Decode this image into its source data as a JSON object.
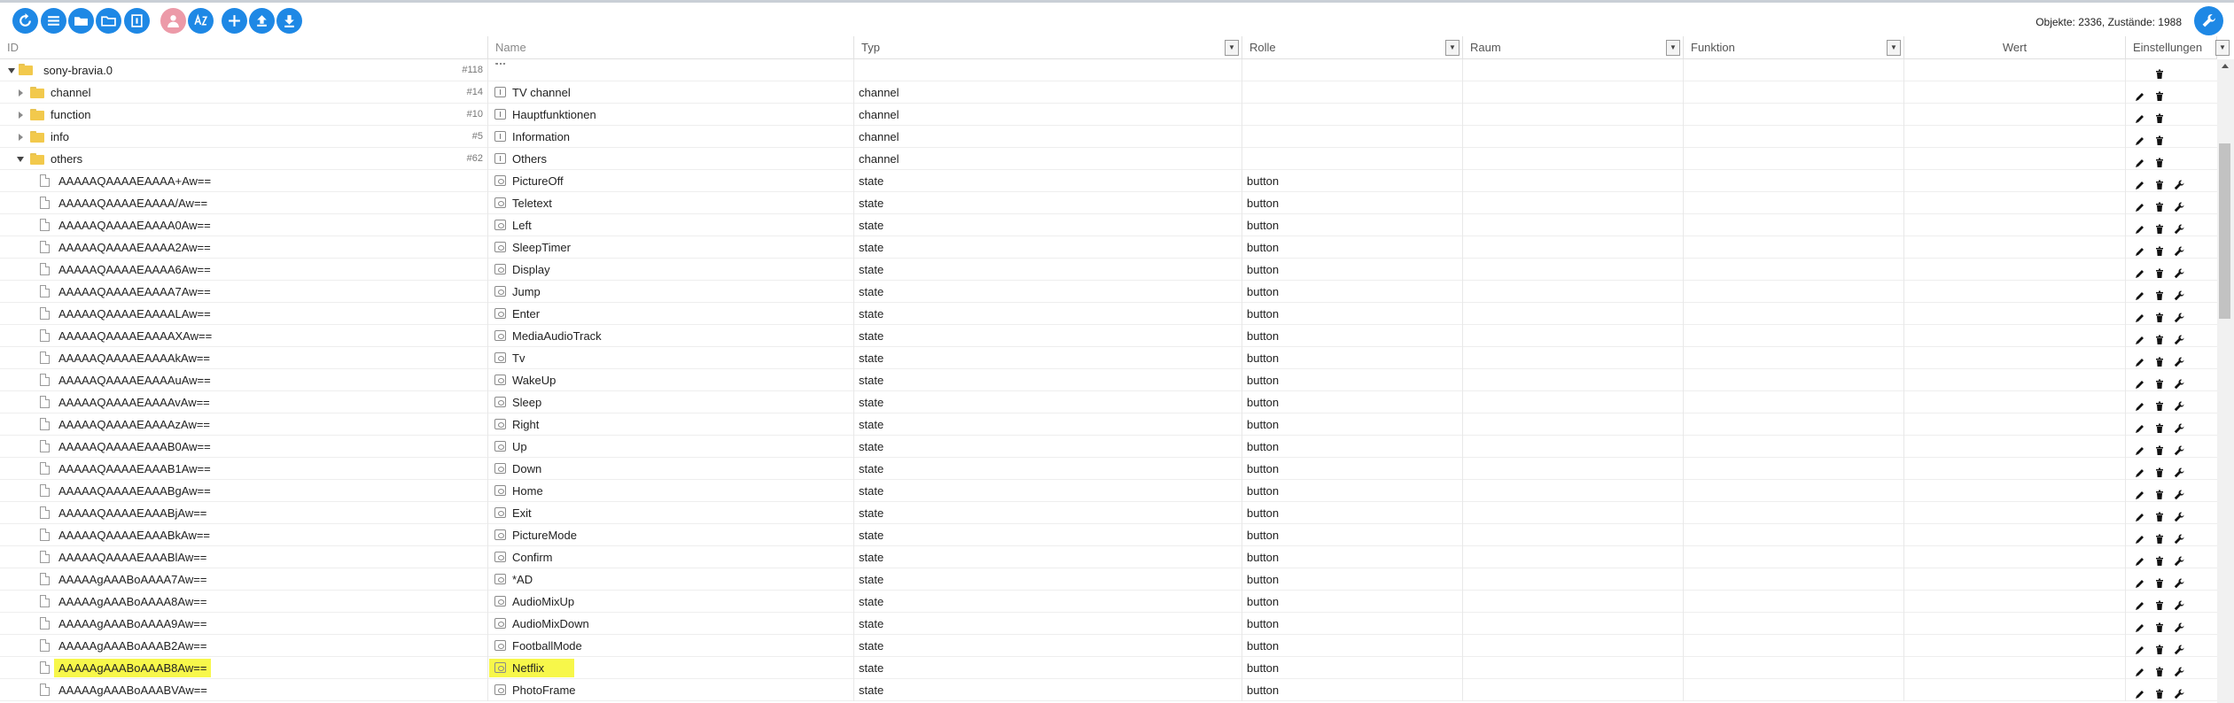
{
  "toolbar": {
    "buttons": [
      "refresh-icon",
      "list-icon",
      "folder-icon",
      "folder-open-icon",
      "expert-icon",
      "user-icon",
      "sort-icon",
      "add-icon",
      "upload-icon",
      "download-icon"
    ],
    "counter_text": "Objekte: 2336, Zustände: 1988",
    "settings_icon": "wrench-icon"
  },
  "colors": {
    "accent": "#1e88e5",
    "highlight": "#f7f74a",
    "folder": "#f2c94c"
  },
  "columns": {
    "id": "ID",
    "name": "Name",
    "typ": "Typ",
    "rolle": "Rolle",
    "raum": "Raum",
    "funktion": "Funktion",
    "wert": "Wert",
    "einstellungen": "Einstellungen"
  },
  "root": {
    "id": "sony-bravia.0",
    "count": "#118"
  },
  "channels": [
    {
      "id": "channel",
      "count": "#14",
      "name": "TV channel",
      "typ": "channel"
    },
    {
      "id": "function",
      "count": "#10",
      "name": "Hauptfunktionen",
      "typ": "channel"
    },
    {
      "id": "info",
      "count": "#5",
      "name": "Information",
      "typ": "channel"
    },
    {
      "id": "others",
      "count": "#62",
      "name": "Others",
      "typ": "channel"
    }
  ],
  "states": [
    {
      "id": "AAAAAQAAAAEAAAA+Aw==",
      "name": "PictureOff",
      "typ": "state",
      "rolle": "button"
    },
    {
      "id": "AAAAAQAAAAEAAAA/Aw==",
      "name": "Teletext",
      "typ": "state",
      "rolle": "button"
    },
    {
      "id": "AAAAAQAAAAEAAAA0Aw==",
      "name": "Left",
      "typ": "state",
      "rolle": "button"
    },
    {
      "id": "AAAAAQAAAAEAAAA2Aw==",
      "name": "SleepTimer",
      "typ": "state",
      "rolle": "button"
    },
    {
      "id": "AAAAAQAAAAEAAAA6Aw==",
      "name": "Display",
      "typ": "state",
      "rolle": "button"
    },
    {
      "id": "AAAAAQAAAAEAAAA7Aw==",
      "name": "Jump",
      "typ": "state",
      "rolle": "button"
    },
    {
      "id": "AAAAAQAAAAEAAAALAw==",
      "name": "Enter",
      "typ": "state",
      "rolle": "button"
    },
    {
      "id": "AAAAAQAAAAEAAAAXAw==",
      "name": "MediaAudioTrack",
      "typ": "state",
      "rolle": "button"
    },
    {
      "id": "AAAAAQAAAAEAAAAkAw==",
      "name": "Tv",
      "typ": "state",
      "rolle": "button"
    },
    {
      "id": "AAAAAQAAAAEAAAAuAw==",
      "name": "WakeUp",
      "typ": "state",
      "rolle": "button"
    },
    {
      "id": "AAAAAQAAAAEAAAAvAw==",
      "name": "Sleep",
      "typ": "state",
      "rolle": "button"
    },
    {
      "id": "AAAAAQAAAAEAAAAzAw==",
      "name": "Right",
      "typ": "state",
      "rolle": "button"
    },
    {
      "id": "AAAAAQAAAAEAAAB0Aw==",
      "name": "Up",
      "typ": "state",
      "rolle": "button"
    },
    {
      "id": "AAAAAQAAAAEAAAB1Aw==",
      "name": "Down",
      "typ": "state",
      "rolle": "button"
    },
    {
      "id": "AAAAAQAAAAEAAABgAw==",
      "name": "Home",
      "typ": "state",
      "rolle": "button"
    },
    {
      "id": "AAAAAQAAAAEAAABjAw==",
      "name": "Exit",
      "typ": "state",
      "rolle": "button"
    },
    {
      "id": "AAAAAQAAAAEAAABkAw==",
      "name": "PictureMode",
      "typ": "state",
      "rolle": "button"
    },
    {
      "id": "AAAAAQAAAAEAAABlAw==",
      "name": "Confirm",
      "typ": "state",
      "rolle": "button"
    },
    {
      "id": "AAAAAgAAABoAAAA7Aw==",
      "name": "*AD",
      "typ": "state",
      "rolle": "button"
    },
    {
      "id": "AAAAAgAAABoAAAA8Aw==",
      "name": "AudioMixUp",
      "typ": "state",
      "rolle": "button"
    },
    {
      "id": "AAAAAgAAABoAAAA9Aw==",
      "name": "AudioMixDown",
      "typ": "state",
      "rolle": "button"
    },
    {
      "id": "AAAAAgAAABoAAAB2Aw==",
      "name": "FootballMode",
      "typ": "state",
      "rolle": "button"
    },
    {
      "id": "AAAAAgAAABoAAAB8Aw==",
      "name": "Netflix",
      "typ": "state",
      "rolle": "button",
      "highlighted": true
    },
    {
      "id": "AAAAAgAAABoAAABVAw==",
      "name": "PhotoFrame",
      "typ": "state",
      "rolle": "button"
    }
  ]
}
